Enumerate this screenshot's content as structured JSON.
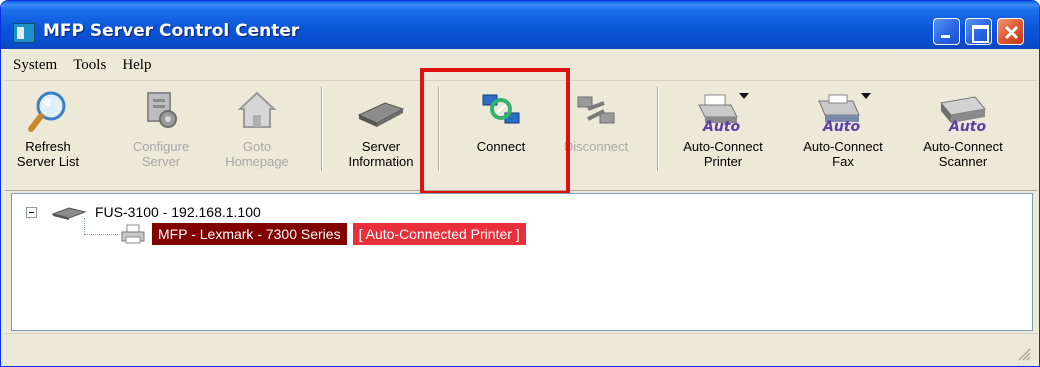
{
  "window": {
    "title": "MFP Server Control Center"
  },
  "menu": {
    "system": "System",
    "tools": "Tools",
    "help": "Help"
  },
  "toolbar": {
    "refresh": {
      "line1": "Refresh",
      "line2": "Server List",
      "icon": "magnifier-icon"
    },
    "configure": {
      "line1": "Configure",
      "line2": "Server",
      "icon": "configure-icon",
      "enabled": false
    },
    "goto": {
      "line1": "Goto",
      "line2": "Homepage",
      "icon": "home-icon",
      "enabled": false
    },
    "server_info": {
      "line1": "Server",
      "line2": "Information",
      "icon": "server-device-icon"
    },
    "connect": {
      "line1": "Connect",
      "icon": "connect-icon"
    },
    "disconnect": {
      "line1": "Disconnect",
      "icon": "disconnect-icon",
      "enabled": false
    },
    "auto_printer": {
      "line1": "Auto-Connect",
      "line2": "Printer",
      "badge": "Auto",
      "icon": "printer-icon"
    },
    "auto_fax": {
      "line1": "Auto-Connect",
      "line2": "Fax",
      "badge": "Auto",
      "icon": "fax-icon"
    },
    "auto_scanner": {
      "line1": "Auto-Connect",
      "line2": "Scanner",
      "badge": "Auto",
      "icon": "scanner-icon"
    }
  },
  "tree": {
    "root": "FUS-3100 - 192.168.1.100",
    "child": "MFP - Lexmark -  7300 Series",
    "child_tag": "[ Auto-Connected Printer ]"
  },
  "colors": {
    "title_blue": "#0b56d9",
    "selection": "#800000",
    "tag_red": "#e8303a",
    "highlight": "#e01010"
  }
}
